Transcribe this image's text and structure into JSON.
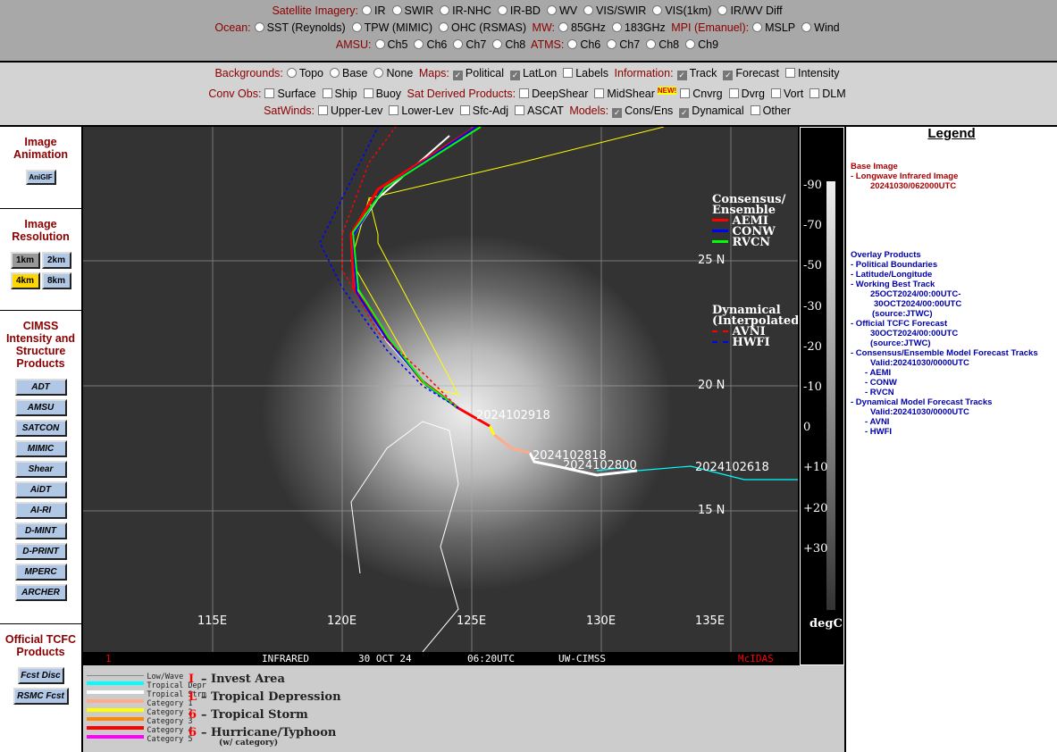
{
  "top": {
    "sat_label": "Satellite Imagery:",
    "sat_opts": [
      "IR",
      "SWIR",
      "IR-NHC",
      "IR-BD",
      "WV",
      "VIS/SWIR",
      "VIS(1km)",
      "IR/WV Diff"
    ],
    "ocean_label": "Ocean:",
    "ocean_opts": [
      "SST (Reynolds)",
      "TPW (MIMIC)",
      "OHC (RSMAS)"
    ],
    "mw_label": "MW:",
    "mw_opts": [
      "85GHz",
      "183GHz"
    ],
    "mpi_label": "MPI (Emanuel):",
    "mpi_opts": [
      "MSLP",
      "Wind"
    ],
    "amsu_label": "AMSU:",
    "amsu_opts": [
      "Ch5",
      "Ch6",
      "Ch7",
      "Ch8"
    ],
    "atms_label": "ATMS:",
    "atms_opts": [
      "Ch6",
      "Ch7",
      "Ch8",
      "Ch9"
    ]
  },
  "overlays": {
    "bg_label": "Backgrounds:",
    "bg_opts": [
      "Topo",
      "Base",
      "None"
    ],
    "maps_label": "Maps:",
    "maps_opts": [
      "Political",
      "LatLon",
      "Labels"
    ],
    "info_label": "Information:",
    "info_opts": [
      "Track",
      "Forecast",
      "Intensity"
    ],
    "conv_label": "Conv Obs:",
    "conv_opts": [
      "Surface",
      "Ship",
      "Buoy"
    ],
    "sdp_label": "Sat Derived Products:",
    "sdp_opts": [
      "DeepShear",
      "MidShear",
      "Cnvrg",
      "Dvrg",
      "Vort",
      "DLM"
    ],
    "new_badge": "NEW!",
    "satw_label": "SatWinds:",
    "satw_opts": [
      "Upper-Lev",
      "Lower-Lev",
      "Sfc-Adj",
      "ASCAT"
    ],
    "models_label": "Models:",
    "models_opts": [
      "Cons/Ens",
      "Dynamical",
      "Other"
    ]
  },
  "sidebar": {
    "anim_title": "Image Animation",
    "anim_btn": "AniGIF",
    "res_title": "Image Resolution",
    "res_btns": [
      "1km",
      "2km",
      "4km",
      "8km"
    ],
    "cimss_title": "CIMSS Intensity and Structure Products",
    "cimss_btns": [
      "ADT",
      "AMSU",
      "SATCON",
      "MIMIC",
      "Shear",
      "AiDT",
      "AI-RI",
      "D-MINT",
      "D-PRINT",
      "MPERC",
      "ARCHER"
    ],
    "tcfc_title": "Official TCFC Products",
    "tcfc_btns": [
      "Fcst Disc",
      "RSMC Fcst"
    ]
  },
  "map": {
    "lat_labels": [
      "25 N",
      "20 N",
      "15 N"
    ],
    "lon_labels": [
      "115E",
      "120E",
      "125E",
      "130E",
      "135E"
    ],
    "track_labels": [
      "2024102918",
      "2024102818",
      "2024102800",
      "2024102618"
    ],
    "cons_title": "Consensus/ Ensemble",
    "cons_models": [
      "AEMI",
      "CONW",
      "RVCN"
    ],
    "dyn_title": "Dynamical (Interpolated)",
    "dyn_models": [
      "AVNI",
      "HWFI"
    ],
    "bar": {
      "frame": "1",
      "type": "INFRARED",
      "date": "30 OCT 24",
      "time": "06:20UTC",
      "source": "UW-CIMSS",
      "brand": "McIDAS"
    },
    "colors": {
      "aemi": "#ff0000",
      "conw": "#0000ff",
      "rvcn": "#00ff00"
    }
  },
  "colorbar": {
    "ticks": [
      "-90",
      "-70",
      "-50",
      "-30",
      "-20",
      "-10",
      "0",
      "+10",
      "+20",
      "+30"
    ],
    "unit": "degC"
  },
  "legend": {
    "title": "Legend",
    "base_h": "Base Image",
    "base_item": "-  Longwave Infrared Image",
    "base_time": "20241030/062000UTC",
    "ov_h": "Overlay Products",
    "lines": [
      "-  Political Boundaries",
      "-  Latitude/Longitude",
      "-  Working Best Track",
      "25OCT2024/00:00UTC-",
      "30OCT2024/00:00UTC",
      "(source:JTWC)",
      "-  Official TCFC Forecast",
      "30OCT2024/00:00UTC",
      "(source:JTWC)",
      "-  Consensus/Ensemble Model Forecast Tracks",
      "Valid:20241030/0000UTC",
      "- AEMI",
      "- CONW",
      "- RVCN",
      "-  Dynamical Model Forecast Tracks",
      "Valid:20241030/0000UTC",
      "- AVNI",
      "- HWFI"
    ]
  },
  "track_key": {
    "lines": [
      {
        "label": "Low/Wave",
        "color": "#888888"
      },
      {
        "label": "Tropical Depr",
        "color": "#00ffff"
      },
      {
        "label": "Tropical Strm",
        "color": "#ffffff"
      },
      {
        "label": "Category 1",
        "color": "#ffaa88"
      },
      {
        "label": "Category 2",
        "color": "#ffff00"
      },
      {
        "label": "Category 3",
        "color": "#ff8800"
      },
      {
        "label": "Category 4",
        "color": "#ff0000"
      },
      {
        "label": "Category 5",
        "color": "#ff00ff"
      }
    ],
    "symbols": [
      "– Invest Area",
      "– Tropical Depression",
      "– Tropical Storm",
      "– Hurricane/Typhoon"
    ],
    "symbol_glyphs": [
      "I",
      "L",
      "6",
      "6"
    ],
    "note": "(w/ category)"
  }
}
